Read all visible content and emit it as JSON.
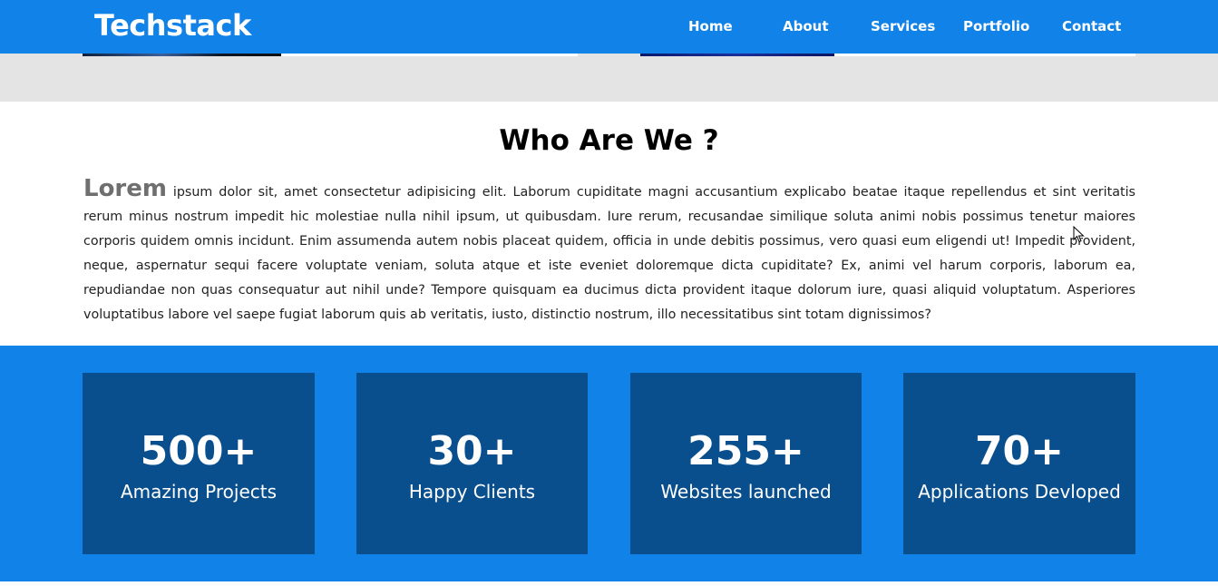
{
  "navbar": {
    "brand": "Techstack",
    "links": [
      "Home",
      "About",
      "Services",
      "Portfolio",
      "Contact"
    ]
  },
  "about": {
    "title": "Who Are We ?",
    "lead_word": "Lorem",
    "body": " ipsum dolor sit, amet consectetur adipisicing elit. Laborum cupiditate magni accusantium explicabo beatae itaque repellendus et sint veritatis rerum minus nostrum impedit hic molestiae nulla nihil ipsum, ut quibusdam. Iure rerum, recusandae similique soluta animi nobis possimus tenetur maiores corporis quidem omnis incidunt. Enim assumenda autem nobis placeat quidem, officia in unde debitis possimus, vero quasi eum eligendi ut! Impedit provident, neque, aspernatur sequi facere voluptate veniam, soluta atque et iste eveniet doloremque dicta cupiditate? Ex, animi vel harum corporis, laborum ea, repudiandae non quas consequatur aut nihil unde? Tempore quisquam ea ducimus dicta provident itaque dolorum iure, quasi aliquid voluptatum. Asperiores voluptatibus labore vel saepe fugiat laborum quis ab veritatis, iusto, distinctio nostrum, illo necessitatibus sint totam dignissimos?"
  },
  "stats": [
    {
      "value": "500+",
      "label": "Amazing Projects"
    },
    {
      "value": "30+",
      "label": "Happy Clients"
    },
    {
      "value": "255+",
      "label": "Websites launched"
    },
    {
      "value": "70+",
      "label": "Applications Devloped"
    }
  ],
  "colors": {
    "primary": "#1082e8",
    "card": "#0a4f8d",
    "strip": "#e4e4e4",
    "lead_word": "#6f6f6f"
  }
}
